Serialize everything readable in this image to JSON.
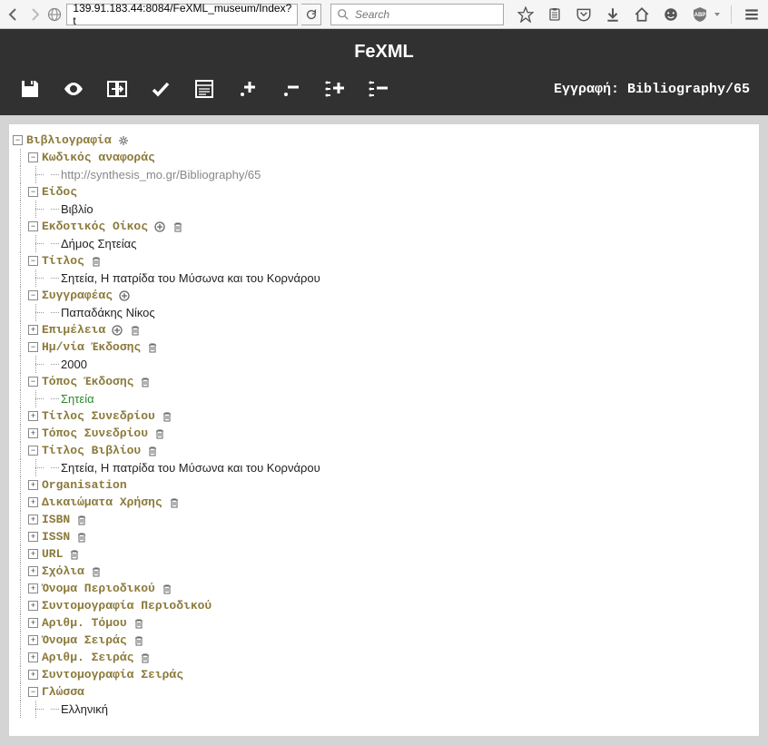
{
  "browser": {
    "url": "139.91.183.44:8084/FeXML_museum/Index?t",
    "search_placeholder": "Search"
  },
  "app": {
    "title": "FeXML",
    "record_label": "Εγγραφή: Bibliography/65"
  },
  "tree": {
    "root_label": "Βιβλιογραφία",
    "nodes": [
      {
        "type": "field",
        "label": "Κωδικός αναφοράς",
        "toggle": "-",
        "actions": [],
        "depth": 1
      },
      {
        "type": "value",
        "value": "http://synthesis_mo.gr/Bibliography/65",
        "style": "grey",
        "depth": 2
      },
      {
        "type": "field",
        "label": "Είδος",
        "toggle": "-",
        "actions": [],
        "depth": 1
      },
      {
        "type": "value",
        "value": "Βιβλίο",
        "depth": 2
      },
      {
        "type": "field",
        "label": "Εκδοτικός Οίκος",
        "toggle": "-",
        "actions": [
          "add",
          "del"
        ],
        "depth": 1
      },
      {
        "type": "value",
        "value": "Δήμος Σητείας",
        "depth": 2
      },
      {
        "type": "field",
        "label": "Τίτλος",
        "toggle": "-",
        "actions": [
          "del"
        ],
        "depth": 1
      },
      {
        "type": "value",
        "value": "Σητεία, Η πατρίδα του Μύσωνα και του Κορνάρου",
        "depth": 2
      },
      {
        "type": "field",
        "label": "Συγγραφέας",
        "toggle": "-",
        "actions": [
          "add"
        ],
        "depth": 1
      },
      {
        "type": "value",
        "value": "Παπαδάκης Νίκος",
        "depth": 2
      },
      {
        "type": "field",
        "label": "Επιμέλεια",
        "toggle": "+",
        "actions": [
          "add",
          "del"
        ],
        "depth": 1
      },
      {
        "type": "field",
        "label": "Ημ/νία Έκδοσης",
        "toggle": "-",
        "actions": [
          "del"
        ],
        "depth": 1
      },
      {
        "type": "value",
        "value": "2000",
        "depth": 2
      },
      {
        "type": "field",
        "label": "Τόπος Έκδοσης",
        "toggle": "-",
        "actions": [
          "del"
        ],
        "depth": 1
      },
      {
        "type": "value",
        "value": "Σητεία",
        "style": "green",
        "depth": 2
      },
      {
        "type": "field",
        "label": "Τίτλος Συνεδρίου",
        "toggle": "+",
        "actions": [
          "del"
        ],
        "depth": 1
      },
      {
        "type": "field",
        "label": "Τόπος Συνεδρίου",
        "toggle": "+",
        "actions": [
          "del"
        ],
        "depth": 1
      },
      {
        "type": "field",
        "label": "Τίτλος Βιβλίου",
        "toggle": "-",
        "actions": [
          "del"
        ],
        "depth": 1
      },
      {
        "type": "value",
        "value": "Σητεία, Η πατρίδα του Μύσωνα και του Κορνάρου",
        "depth": 2
      },
      {
        "type": "field",
        "label": "Organisation",
        "toggle": "+",
        "actions": [],
        "depth": 1
      },
      {
        "type": "field",
        "label": "Δικαιώματα Χρήσης",
        "toggle": "+",
        "actions": [
          "del"
        ],
        "depth": 1
      },
      {
        "type": "field",
        "label": "ISBN",
        "toggle": "+",
        "actions": [
          "del"
        ],
        "depth": 1
      },
      {
        "type": "field",
        "label": "ISSN",
        "toggle": "+",
        "actions": [
          "del"
        ],
        "depth": 1
      },
      {
        "type": "field",
        "label": "URL",
        "toggle": "+",
        "actions": [
          "del"
        ],
        "depth": 1
      },
      {
        "type": "field",
        "label": "Σχόλια",
        "toggle": "+",
        "actions": [
          "del"
        ],
        "depth": 1
      },
      {
        "type": "field",
        "label": "Όνομα Περιοδικού",
        "toggle": "+",
        "actions": [
          "del"
        ],
        "depth": 1
      },
      {
        "type": "field",
        "label": "Συντομογραφία Περιοδικού",
        "toggle": "+",
        "actions": [],
        "depth": 1
      },
      {
        "type": "field",
        "label": "Αριθμ. Τόμου",
        "toggle": "+",
        "actions": [
          "del"
        ],
        "depth": 1
      },
      {
        "type": "field",
        "label": "Όνομα Σειράς",
        "toggle": "+",
        "actions": [
          "del"
        ],
        "depth": 1
      },
      {
        "type": "field",
        "label": "Αριθμ. Σειράς",
        "toggle": "+",
        "actions": [
          "del"
        ],
        "depth": 1
      },
      {
        "type": "field",
        "label": "Συντομογραφία Σειράς",
        "toggle": "+",
        "actions": [],
        "depth": 1
      },
      {
        "type": "field",
        "label": "Γλώσσα",
        "toggle": "-",
        "actions": [],
        "depth": 1
      },
      {
        "type": "value",
        "value": "Ελληνική",
        "depth": 2
      }
    ]
  }
}
